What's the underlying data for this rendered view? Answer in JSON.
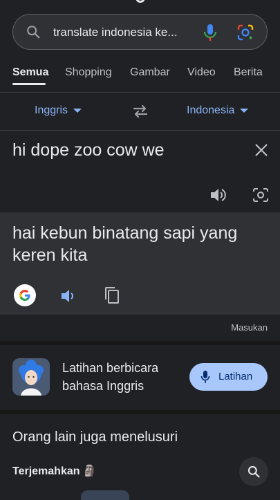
{
  "search": {
    "query": "translate indonesia ke..."
  },
  "tabs": [
    {
      "label": "Semua"
    },
    {
      "label": "Shopping"
    },
    {
      "label": "Gambar"
    },
    {
      "label": "Video"
    },
    {
      "label": "Berita"
    }
  ],
  "translator": {
    "source_lang": "Inggris",
    "target_lang": "Indonesia",
    "source_text": "hi dope zoo cow we",
    "result_text": "hai kebun binatang sapi yang keren kita",
    "feedback_label": "Masukan"
  },
  "practice": {
    "title": "Latihan berbicara bahasa Inggris",
    "button_label": "Latihan"
  },
  "related": {
    "title": "Orang lain juga menelusuri",
    "item_label": "Terjemahkan",
    "item_emoji": "🗿"
  },
  "colors": {
    "background": "#202124",
    "surface": "#303134",
    "accent": "#8ab4f8",
    "button": "#a8c7fa"
  }
}
